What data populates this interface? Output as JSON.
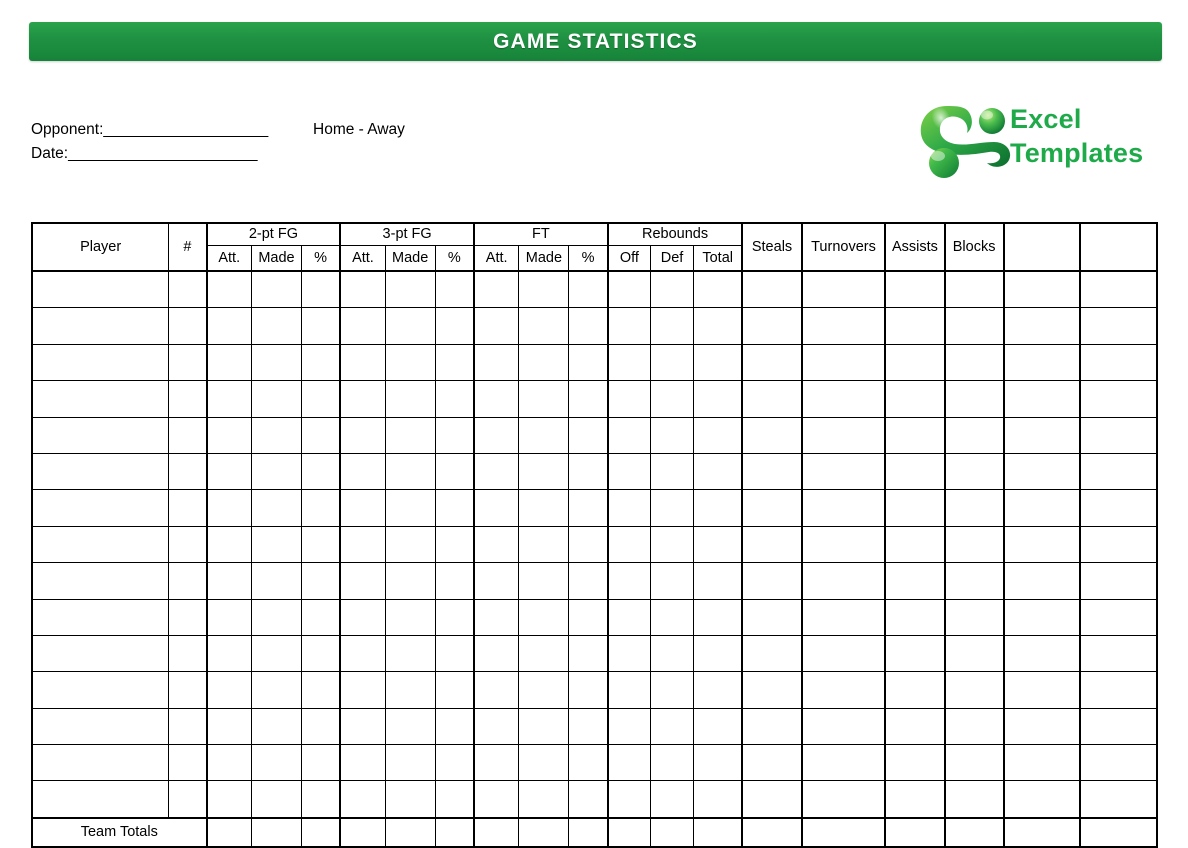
{
  "banner": {
    "title": "GAME STATISTICS",
    "color": "#1f9042"
  },
  "meta": {
    "opponent_label": "Opponent:",
    "opponent_blank": "____________________",
    "date_label": "Date:",
    "date_blank": "_______________________",
    "home_away": "Home - Away"
  },
  "logo": {
    "icon": "excel-templates-swoosh-icon",
    "line1": "Excel",
    "line2": "Templates",
    "color": "#1faa4a"
  },
  "table": {
    "group_headers": {
      "player": "",
      "number": "",
      "two_pt": "2-pt FG",
      "three_pt": "3-pt FG",
      "ft": "FT",
      "rebounds": "Rebounds",
      "steals": "",
      "turnovers": "",
      "assists": "",
      "blocks": "",
      "extra1": "",
      "extra2": ""
    },
    "sub_headers": {
      "player": "Player",
      "number": "#",
      "two_pt_att": "Att.",
      "two_pt_made": "Made",
      "two_pt_pct": "%",
      "three_pt_att": "Att.",
      "three_pt_made": "Made",
      "three_pt_pct": "%",
      "ft_att": "Att.",
      "ft_made": "Made",
      "ft_pct": "%",
      "reb_off": "Off",
      "reb_def": "Def",
      "reb_total": "Total",
      "steals": "Steals",
      "turnovers": "Turnovers",
      "assists": "Assists",
      "blocks": "Blocks",
      "extra1": "",
      "extra2": ""
    },
    "row_count": 15,
    "rows": [
      {
        "player": "",
        "number": "",
        "two_pt_att": "",
        "two_pt_made": "",
        "two_pt_pct": "",
        "three_pt_att": "",
        "three_pt_made": "",
        "three_pt_pct": "",
        "ft_att": "",
        "ft_made": "",
        "ft_pct": "",
        "reb_off": "",
        "reb_def": "",
        "reb_total": "",
        "steals": "",
        "turnovers": "",
        "assists": "",
        "blocks": "",
        "extra1": "",
        "extra2": ""
      },
      {
        "player": "",
        "number": "",
        "two_pt_att": "",
        "two_pt_made": "",
        "two_pt_pct": "",
        "three_pt_att": "",
        "three_pt_made": "",
        "three_pt_pct": "",
        "ft_att": "",
        "ft_made": "",
        "ft_pct": "",
        "reb_off": "",
        "reb_def": "",
        "reb_total": "",
        "steals": "",
        "turnovers": "",
        "assists": "",
        "blocks": "",
        "extra1": "",
        "extra2": ""
      },
      {
        "player": "",
        "number": "",
        "two_pt_att": "",
        "two_pt_made": "",
        "two_pt_pct": "",
        "three_pt_att": "",
        "three_pt_made": "",
        "three_pt_pct": "",
        "ft_att": "",
        "ft_made": "",
        "ft_pct": "",
        "reb_off": "",
        "reb_def": "",
        "reb_total": "",
        "steals": "",
        "turnovers": "",
        "assists": "",
        "blocks": "",
        "extra1": "",
        "extra2": ""
      },
      {
        "player": "",
        "number": "",
        "two_pt_att": "",
        "two_pt_made": "",
        "two_pt_pct": "",
        "three_pt_att": "",
        "three_pt_made": "",
        "three_pt_pct": "",
        "ft_att": "",
        "ft_made": "",
        "ft_pct": "",
        "reb_off": "",
        "reb_def": "",
        "reb_total": "",
        "steals": "",
        "turnovers": "",
        "assists": "",
        "blocks": "",
        "extra1": "",
        "extra2": ""
      },
      {
        "player": "",
        "number": "",
        "two_pt_att": "",
        "two_pt_made": "",
        "two_pt_pct": "",
        "three_pt_att": "",
        "three_pt_made": "",
        "three_pt_pct": "",
        "ft_att": "",
        "ft_made": "",
        "ft_pct": "",
        "reb_off": "",
        "reb_def": "",
        "reb_total": "",
        "steals": "",
        "turnovers": "",
        "assists": "",
        "blocks": "",
        "extra1": "",
        "extra2": ""
      },
      {
        "player": "",
        "number": "",
        "two_pt_att": "",
        "two_pt_made": "",
        "two_pt_pct": "",
        "three_pt_att": "",
        "three_pt_made": "",
        "three_pt_pct": "",
        "ft_att": "",
        "ft_made": "",
        "ft_pct": "",
        "reb_off": "",
        "reb_def": "",
        "reb_total": "",
        "steals": "",
        "turnovers": "",
        "assists": "",
        "blocks": "",
        "extra1": "",
        "extra2": ""
      },
      {
        "player": "",
        "number": "",
        "two_pt_att": "",
        "two_pt_made": "",
        "two_pt_pct": "",
        "three_pt_att": "",
        "three_pt_made": "",
        "three_pt_pct": "",
        "ft_att": "",
        "ft_made": "",
        "ft_pct": "",
        "reb_off": "",
        "reb_def": "",
        "reb_total": "",
        "steals": "",
        "turnovers": "",
        "assists": "",
        "blocks": "",
        "extra1": "",
        "extra2": ""
      },
      {
        "player": "",
        "number": "",
        "two_pt_att": "",
        "two_pt_made": "",
        "two_pt_pct": "",
        "three_pt_att": "",
        "three_pt_made": "",
        "three_pt_pct": "",
        "ft_att": "",
        "ft_made": "",
        "ft_pct": "",
        "reb_off": "",
        "reb_def": "",
        "reb_total": "",
        "steals": "",
        "turnovers": "",
        "assists": "",
        "blocks": "",
        "extra1": "",
        "extra2": ""
      },
      {
        "player": "",
        "number": "",
        "two_pt_att": "",
        "two_pt_made": "",
        "two_pt_pct": "",
        "three_pt_att": "",
        "three_pt_made": "",
        "three_pt_pct": "",
        "ft_att": "",
        "ft_made": "",
        "ft_pct": "",
        "reb_off": "",
        "reb_def": "",
        "reb_total": "",
        "steals": "",
        "turnovers": "",
        "assists": "",
        "blocks": "",
        "extra1": "",
        "extra2": ""
      },
      {
        "player": "",
        "number": "",
        "two_pt_att": "",
        "two_pt_made": "",
        "two_pt_pct": "",
        "three_pt_att": "",
        "three_pt_made": "",
        "three_pt_pct": "",
        "ft_att": "",
        "ft_made": "",
        "ft_pct": "",
        "reb_off": "",
        "reb_def": "",
        "reb_total": "",
        "steals": "",
        "turnovers": "",
        "assists": "",
        "blocks": "",
        "extra1": "",
        "extra2": ""
      },
      {
        "player": "",
        "number": "",
        "two_pt_att": "",
        "two_pt_made": "",
        "two_pt_pct": "",
        "three_pt_att": "",
        "three_pt_made": "",
        "three_pt_pct": "",
        "ft_att": "",
        "ft_made": "",
        "ft_pct": "",
        "reb_off": "",
        "reb_def": "",
        "reb_total": "",
        "steals": "",
        "turnovers": "",
        "assists": "",
        "blocks": "",
        "extra1": "",
        "extra2": ""
      },
      {
        "player": "",
        "number": "",
        "two_pt_att": "",
        "two_pt_made": "",
        "two_pt_pct": "",
        "three_pt_att": "",
        "three_pt_made": "",
        "three_pt_pct": "",
        "ft_att": "",
        "ft_made": "",
        "ft_pct": "",
        "reb_off": "",
        "reb_def": "",
        "reb_total": "",
        "steals": "",
        "turnovers": "",
        "assists": "",
        "blocks": "",
        "extra1": "",
        "extra2": ""
      },
      {
        "player": "",
        "number": "",
        "two_pt_att": "",
        "two_pt_made": "",
        "two_pt_pct": "",
        "three_pt_att": "",
        "three_pt_made": "",
        "three_pt_pct": "",
        "ft_att": "",
        "ft_made": "",
        "ft_pct": "",
        "reb_off": "",
        "reb_def": "",
        "reb_total": "",
        "steals": "",
        "turnovers": "",
        "assists": "",
        "blocks": "",
        "extra1": "",
        "extra2": ""
      },
      {
        "player": "",
        "number": "",
        "two_pt_att": "",
        "two_pt_made": "",
        "two_pt_pct": "",
        "three_pt_att": "",
        "three_pt_made": "",
        "three_pt_pct": "",
        "ft_att": "",
        "ft_made": "",
        "ft_pct": "",
        "reb_off": "",
        "reb_def": "",
        "reb_total": "",
        "steals": "",
        "turnovers": "",
        "assists": "",
        "blocks": "",
        "extra1": "",
        "extra2": ""
      },
      {
        "player": "",
        "number": "",
        "two_pt_att": "",
        "two_pt_made": "",
        "two_pt_pct": "",
        "three_pt_att": "",
        "three_pt_made": "",
        "three_pt_pct": "",
        "ft_att": "",
        "ft_made": "",
        "ft_pct": "",
        "reb_off": "",
        "reb_def": "",
        "reb_total": "",
        "steals": "",
        "turnovers": "",
        "assists": "",
        "blocks": "",
        "extra1": "",
        "extra2": ""
      }
    ],
    "totals_row": {
      "label": "Team Totals",
      "two_pt_att": "",
      "two_pt_made": "",
      "two_pt_pct": "",
      "three_pt_att": "",
      "three_pt_made": "",
      "three_pt_pct": "",
      "ft_att": "",
      "ft_made": "",
      "ft_pct": "",
      "reb_off": "",
      "reb_def": "",
      "reb_total": "",
      "steals": "",
      "turnovers": "",
      "assists": "",
      "blocks": "",
      "extra1": "",
      "extra2": ""
    }
  }
}
